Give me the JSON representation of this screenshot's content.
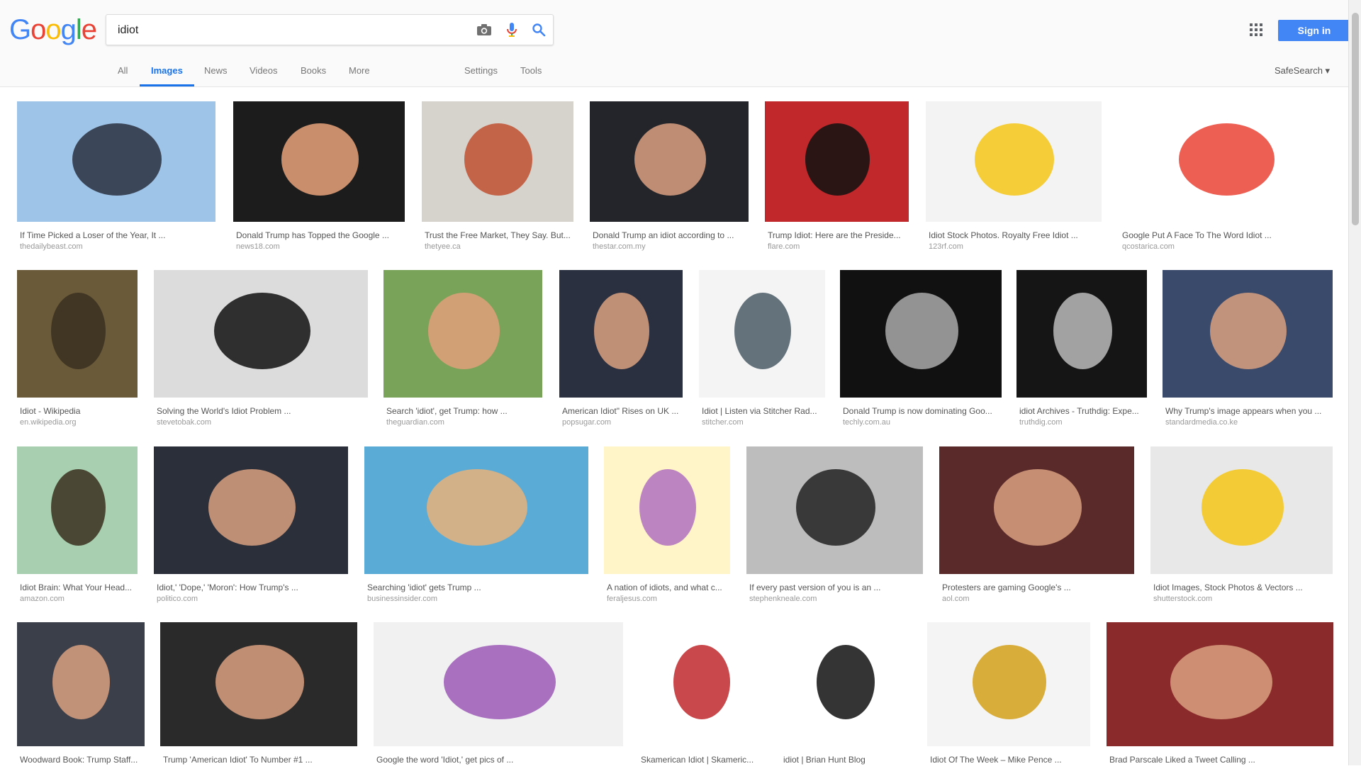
{
  "logo": {
    "letters": [
      "G",
      "o",
      "o",
      "g",
      "l",
      "e"
    ],
    "colors": [
      "#4285f4",
      "#ea4335",
      "#fbbc05",
      "#4285f4",
      "#34a853",
      "#ea4335"
    ]
  },
  "search": {
    "query": "idiot"
  },
  "header": {
    "signin_label": "Sign in",
    "safesearch_label": "SafeSearch ▾"
  },
  "tabs": [
    "All",
    "Images",
    "News",
    "Videos",
    "Books",
    "More",
    "Settings",
    "Tools"
  ],
  "results": [
    {
      "caption": "If Time Picked a Loser of the Year, It ...",
      "source": "thedailybeast.com",
      "bg": "#9ec4e8",
      "fg": "#2a3040"
    },
    {
      "caption": "Donald Trump has Topped the Google ...",
      "source": "news18.com",
      "bg": "#1c1c1c",
      "fg": "#e8a27a"
    },
    {
      "caption": "Trust the Free Market, They Say. But...",
      "source": "thetyee.ca",
      "bg": "#d6d2cc",
      "fg": "#c05030"
    },
    {
      "caption": "Donald Trump an idiot according to ...",
      "source": "thestar.com.my",
      "bg": "#23252b",
      "fg": "#d9a080"
    },
    {
      "caption": "Trump Idiot: Here are the Preside...",
      "source": "flare.com",
      "bg": "#c0282b",
      "fg": "#111"
    },
    {
      "caption": "Idiot Stock Photos. Royalty Free Idiot ...",
      "source": "123rf.com",
      "bg": "#f3f3f3",
      "fg": "#f5c518"
    },
    {
      "caption": "Google Put A Face To The Word Idiot ...",
      "source": "qcostarica.com",
      "bg": "#ffffff",
      "fg": "#ea4335"
    },
    {
      "caption": "Idiot - Wikipedia",
      "source": "en.wikipedia.org",
      "bg": "#6a5a3a",
      "fg": "#3a3020"
    },
    {
      "caption": "Solving the World's Idiot Problem ...",
      "source": "stevetobak.com",
      "bg": "#dcdcdc",
      "fg": "#111"
    },
    {
      "caption": "Search 'idiot', get Trump: how ...",
      "source": "theguardian.com",
      "bg": "#7aa35a",
      "fg": "#e0a07a"
    },
    {
      "caption": "American Idiot\" Rises on UK ...",
      "source": "popsugar.com",
      "bg": "#2a3040",
      "fg": "#d9a080"
    },
    {
      "caption": "Idiot | Listen via Stitcher Rad...",
      "source": "stitcher.com",
      "bg": "#f4f4f4",
      "fg": "#4a5a66"
    },
    {
      "caption": "Donald Trump is now dominating Goo...",
      "source": "techly.com.au",
      "bg": "#111",
      "fg": "#aaa"
    },
    {
      "caption": "idiot Archives - Truthdig: Expe...",
      "source": "truthdig.com",
      "bg": "#151515",
      "fg": "#bbb"
    },
    {
      "caption": "Why Trump's image appears when you ...",
      "source": "standardmedia.co.ke",
      "bg": "#3a4a6a",
      "fg": "#d9a080"
    },
    {
      "caption": "Idiot Brain: What Your Head...",
      "source": "amazon.com",
      "bg": "#a8d0b0",
      "fg": "#3a3020"
    },
    {
      "caption": "Idiot,' 'Dope,' 'Moron': How Trump's ...",
      "source": "politico.com",
      "bg": "#2a2f3a",
      "fg": "#d9a080"
    },
    {
      "caption": "Searching 'idiot' gets Trump ...",
      "source": "businessinsider.com",
      "bg": "#5aacd6",
      "fg": "#e8b07a"
    },
    {
      "caption": "A nation of idiots, and what c...",
      "source": "feraljesus.com",
      "bg": "#fff5c8",
      "fg": "#b070c0"
    },
    {
      "caption": "If every past version of you is an ...",
      "source": "stephenkneale.com",
      "bg": "#bdbdbd",
      "fg": "#222"
    },
    {
      "caption": "Protesters are gaming Google's ...",
      "source": "aol.com",
      "bg": "#5a2a2a",
      "fg": "#d9a080"
    },
    {
      "caption": "Idiot Images, Stock Photos & Vectors ...",
      "source": "shutterstock.com",
      "bg": "#e8e8e8",
      "fg": "#f5c518"
    },
    {
      "caption": "Woodward Book: Trump Staff...",
      "source": "",
      "bg": "#3a3f4a",
      "fg": "#d9a080"
    },
    {
      "caption": "Trump 'American Idiot' To Number #1 ...",
      "source": "",
      "bg": "#2a2a2a",
      "fg": "#d9a080"
    },
    {
      "caption": "Google the word 'Idiot,' get pics of ...",
      "source": "",
      "bg": "#f1f1f1",
      "fg": "#9b59b6"
    },
    {
      "caption": "Skamerican Idiot | Skameric...",
      "source": "",
      "bg": "#ffffff",
      "fg": "#c0282b"
    },
    {
      "caption": "idiot | Brian Hunt Blog",
      "source": "",
      "bg": "#ffffff",
      "fg": "#111"
    },
    {
      "caption": "Idiot Of The Week – Mike Pence ...",
      "source": "",
      "bg": "#f4f4f4",
      "fg": "#d4a017"
    },
    {
      "caption": "Brad Parscale Liked a Tweet Calling ...",
      "source": "",
      "bg": "#8a2a2a",
      "fg": "#d9a080"
    }
  ]
}
